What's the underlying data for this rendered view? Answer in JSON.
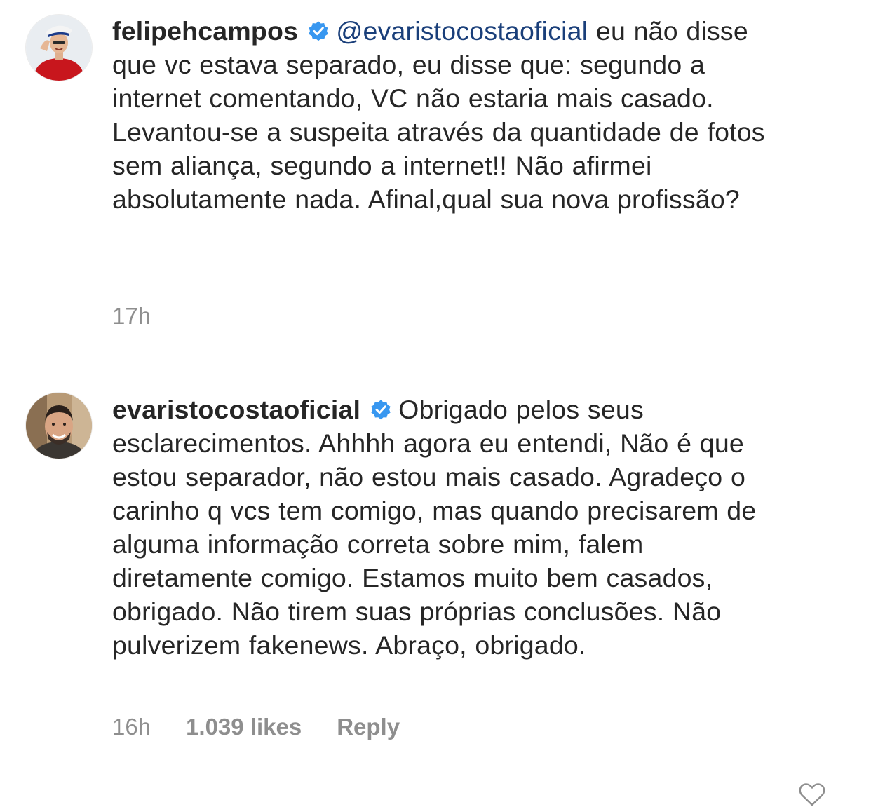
{
  "comments": [
    {
      "username": "felipehcampos",
      "verified": true,
      "mention": "@evaristocostaoficial",
      "text": " eu não disse que vc estava separado, eu disse que: segundo a internet comentando, VC não estaria mais casado. Levantou-se a suspeita através da quantidade de fotos sem aliança, segundo a internet!! Não afirmei absolutamente nada. Afinal,qual sua nova profissão?",
      "time": "17h"
    },
    {
      "username": "evaristocostaoficial",
      "verified": true,
      "text": "Obrigado pelos seus esclarecimentos. Ahhhh agora eu entendi, Não é que estou separador, não estou mais casado. Agradeço o carinho q vcs tem comigo, mas quando precisarem de alguma informação correta sobre mim, falem diretamente comigo. Estamos muito bem casados, obrigado. Não tirem suas próprias conclusões. Não pulverizem fakenews. Abraço, obrigado.",
      "time": "16h",
      "likes": "1.039 likes",
      "reply_label": "Reply"
    }
  ],
  "icons": {
    "verified": "verified-badge-icon",
    "like": "heart-outline-icon"
  },
  "colors": {
    "text": "#262626",
    "meta": "#8e8e8e",
    "mention": "#1a3f7a",
    "verified": "#3897f0",
    "divider": "#dbdbdb"
  }
}
